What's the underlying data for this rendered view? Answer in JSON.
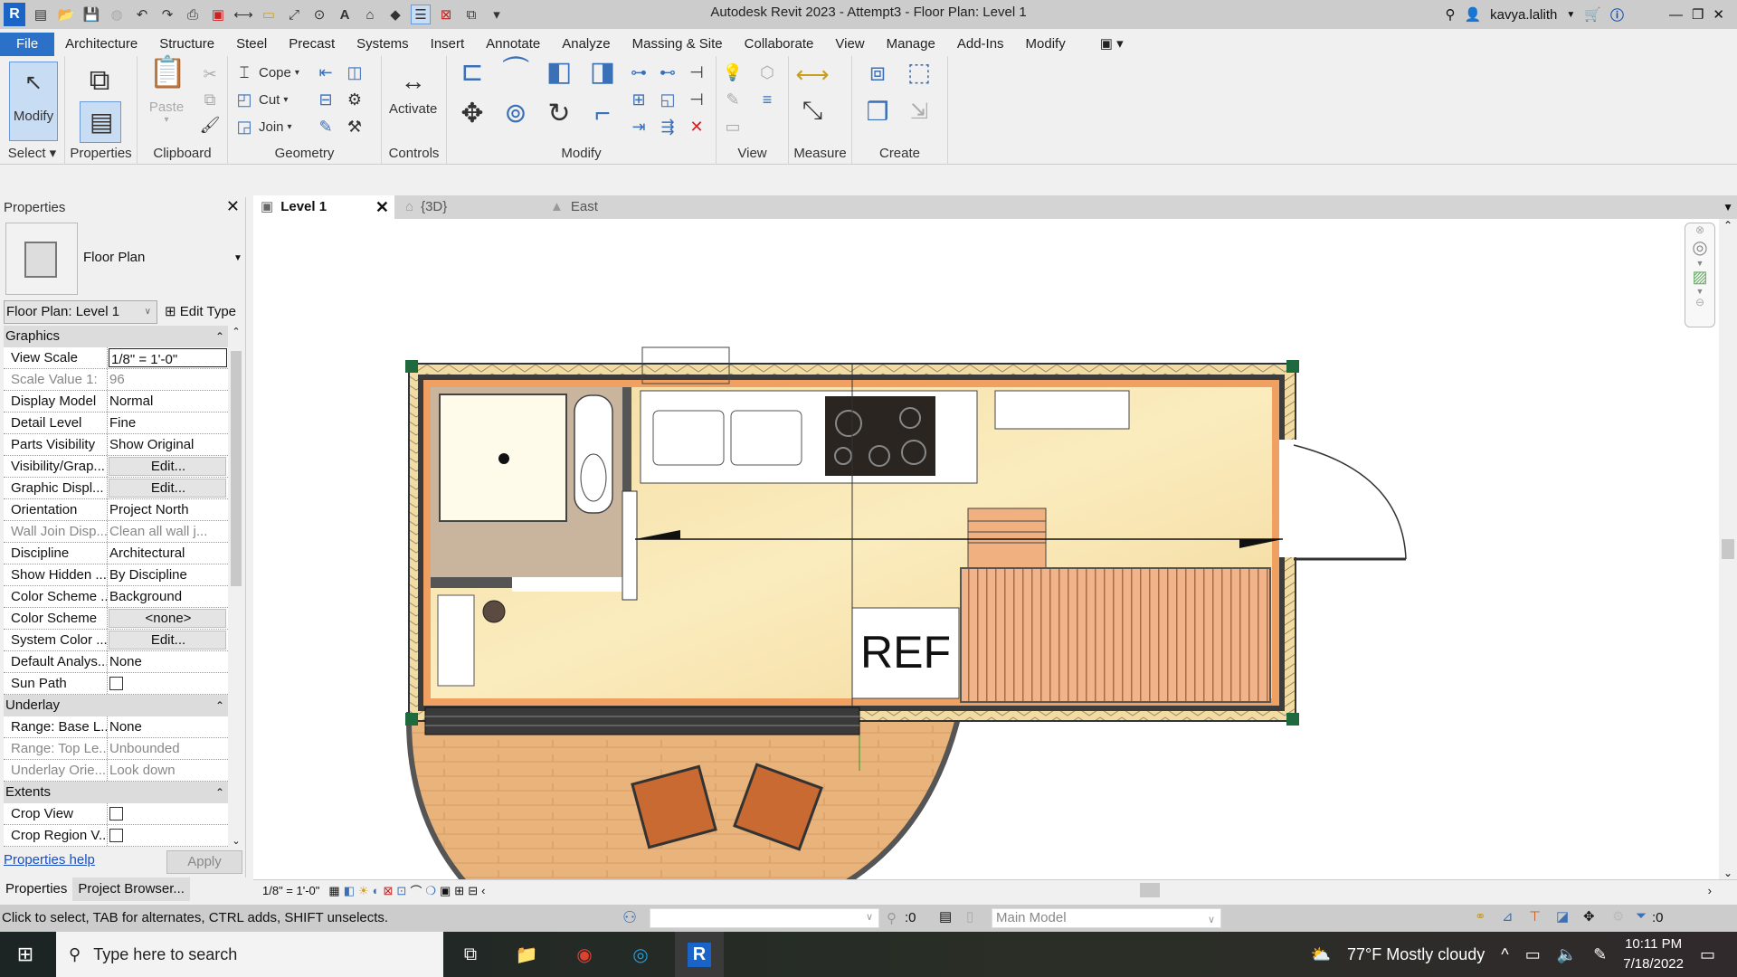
{
  "window": {
    "title": "Autodesk Revit 2023 - Attempt3 - Floor Plan: Level 1",
    "user": "kavya.lalith"
  },
  "quick_access": [
    "app-menu",
    "open",
    "save",
    "sync",
    "undo",
    "redo",
    "print",
    "export-pdf",
    "aligned-dimension",
    "measure",
    "tag",
    "text",
    "default-3d-view",
    "section",
    "thin-lines",
    "close-inactive",
    "switch-windows",
    "customize"
  ],
  "ribbon_tabs": [
    {
      "label": "File"
    },
    {
      "label": "Architecture"
    },
    {
      "label": "Structure"
    },
    {
      "label": "Steel"
    },
    {
      "label": "Precast"
    },
    {
      "label": "Systems"
    },
    {
      "label": "Insert"
    },
    {
      "label": "Annotate"
    },
    {
      "label": "Analyze"
    },
    {
      "label": "Massing & Site"
    },
    {
      "label": "Collaborate"
    },
    {
      "label": "View"
    },
    {
      "label": "Manage"
    },
    {
      "label": "Add-Ins"
    },
    {
      "label": "Modify"
    }
  ],
  "ribbon": {
    "modify_label": "Modify",
    "paste_label": "Paste",
    "cope_label": "Cope",
    "cut_label": "Cut",
    "join_label": "Join",
    "activate_label": "Activate",
    "panels": {
      "select": "Select",
      "properties": "Properties",
      "clipboard": "Clipboard",
      "geometry": "Geometry",
      "controls": "Controls",
      "modify": "Modify",
      "view": "View",
      "measure": "Measure",
      "create": "Create"
    }
  },
  "properties": {
    "title": "Properties",
    "type_name": "Floor Plan",
    "instance_selector": "Floor Plan: Level 1",
    "edit_type_label": "Edit Type",
    "groups": [
      {
        "name": "Graphics",
        "rows": [
          {
            "key": "View Scale",
            "value": "1/8\" = 1'-0\"",
            "kind": "input"
          },
          {
            "key": "Scale Value    1:",
            "value": "96",
            "kind": "dim"
          },
          {
            "key": "Display Model",
            "value": "Normal"
          },
          {
            "key": "Detail Level",
            "value": "Fine"
          },
          {
            "key": "Parts Visibility",
            "value": "Show Original"
          },
          {
            "key": "Visibility/Grap...",
            "value": "Edit...",
            "kind": "button"
          },
          {
            "key": "Graphic Displ...",
            "value": "Edit...",
            "kind": "button"
          },
          {
            "key": "Orientation",
            "value": "Project North"
          },
          {
            "key": "Wall Join Disp...",
            "value": "Clean all wall j...",
            "kind": "dim"
          },
          {
            "key": "Discipline",
            "value": "Architectural"
          },
          {
            "key": "Show Hidden ...",
            "value": "By Discipline"
          },
          {
            "key": "Color Scheme ...",
            "value": "Background"
          },
          {
            "key": "Color Scheme",
            "value": "<none>",
            "kind": "button"
          },
          {
            "key": "System Color ...",
            "value": "Edit...",
            "kind": "button"
          },
          {
            "key": "Default Analys...",
            "value": "None"
          },
          {
            "key": "Sun Path",
            "value": "",
            "kind": "checkbox",
            "checked": false
          }
        ]
      },
      {
        "name": "Underlay",
        "rows": [
          {
            "key": "Range: Base L...",
            "value": "None"
          },
          {
            "key": "Range: Top Le...",
            "value": "Unbounded",
            "kind": "dim"
          },
          {
            "key": "Underlay Orie...",
            "value": "Look down",
            "kind": "dim"
          }
        ]
      },
      {
        "name": "Extents",
        "rows": [
          {
            "key": "Crop View",
            "value": "",
            "kind": "checkbox",
            "checked": false
          },
          {
            "key": "Crop Region V...",
            "value": "",
            "kind": "checkbox",
            "checked": false
          }
        ]
      }
    ],
    "help_link": "Properties help",
    "apply_label": "Apply",
    "bottom_tabs": [
      "Properties",
      "Project Browser..."
    ]
  },
  "view_tabs": [
    {
      "label": "Level 1",
      "active": true
    },
    {
      "label": "{3D}",
      "active": false
    },
    {
      "label": "East",
      "active": false
    }
  ],
  "canvas": {
    "ref_label": "REF"
  },
  "view_control": {
    "scale": "1/8\" = 1'-0\""
  },
  "status_bar": {
    "hint": "Click to select, TAB for alternates, CTRL adds, SHIFT unselects.",
    "editable_count": ":0",
    "model": "Main Model",
    "filter_count": ":0"
  },
  "taskbar": {
    "search_placeholder": "Type here to search",
    "weather": "77°F  Mostly cloudy",
    "time": "10:11 PM",
    "date": "7/18/2022"
  }
}
